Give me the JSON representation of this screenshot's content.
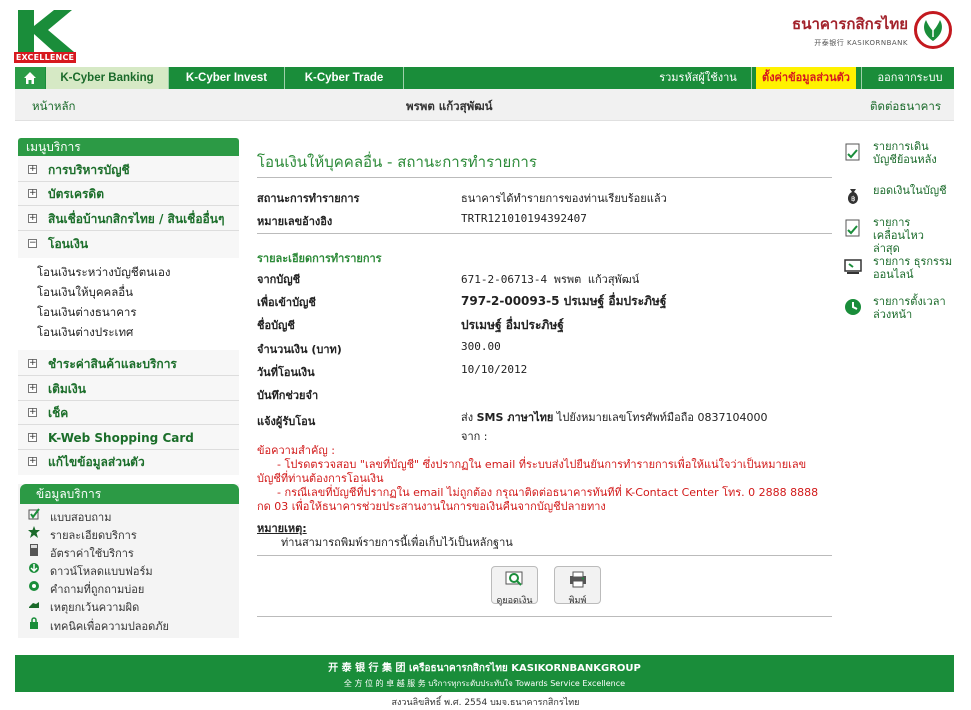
{
  "brand": {
    "k_excellence": "EXCELLENCE",
    "bank_name_th": "ธนาคารกสิกรไทย",
    "bank_name_en": "开泰银行 KASIKORNBANK",
    "brand_green": "#1a8d3a",
    "brand_red": "#d7191f"
  },
  "topnav": {
    "home_icon": "home-icon",
    "tabs": [
      "K-Cyber Banking",
      "K-Cyber Invest",
      "K-Cyber Trade"
    ],
    "change_password": "รวมรหัสผู้ใช้งาน",
    "settings": "ตั้งค่าข้อมูลส่วนตัว",
    "logout": "ออกจากระบบ"
  },
  "subbar": {
    "home": "หน้าหลัก",
    "user_name": "พรพต แก้วสุพัฒน์",
    "contact": "ติดต่อธนาคาร"
  },
  "menu": {
    "title": "เมนูบริการ",
    "items": [
      {
        "label": "การบริหารบัญชี",
        "sign": "⊞"
      },
      {
        "label": "บัตรเครดิต",
        "sign": "⊞"
      },
      {
        "label": "สินเชื่อบ้านกสิกรไทย / สินเชื่ออื่นๆ",
        "sign": "⊞"
      },
      {
        "label": "โอนเงิน",
        "sign": "⊟"
      },
      {
        "label": "ชำระค่าสินค้าและบริการ",
        "sign": "⊞"
      },
      {
        "label": "เติมเงิน",
        "sign": "⊞"
      },
      {
        "label": "เช็ค",
        "sign": "⊞"
      },
      {
        "label": "K-Web Shopping Card",
        "sign": "⊞"
      },
      {
        "label": "แก้ไขข้อมูลส่วนตัว",
        "sign": "⊞"
      }
    ],
    "transfer_sub": [
      "โอนเงินระหว่างบัญชีตนเอง",
      "โอนเงินให้บุคคลอื่น",
      "โอนเงินต่างธนาคาร",
      "โอนเงินต่างประเทศ"
    ]
  },
  "info": {
    "title": "ข้อมูลบริการ",
    "items": [
      {
        "label": "แบบสอบถาม",
        "icon": "checkbox-icon"
      },
      {
        "label": "รายละเอียดบริการ",
        "icon": "star-icon"
      },
      {
        "label": "อัตราค่าใช้บริการ",
        "icon": "calculator-icon"
      },
      {
        "label": "ดาวน์โหลดแบบฟอร์ม",
        "icon": "download-icon"
      },
      {
        "label": "คำถามที่ถูกถามบ่อย",
        "icon": "question-icon"
      },
      {
        "label": "เหตุยกเว้นความผิด",
        "icon": "hand-icon"
      },
      {
        "label": "เทคนิคเพื่อความปลอดภัย",
        "icon": "lock-icon"
      }
    ]
  },
  "main": {
    "title": "โอนเงินให้บุคคลอื่น - สถานะการทำรายการ",
    "status_label": "สถานะการทำรายการ",
    "status_value": "ธนาคารได้ทำรายการของท่านเรียบร้อยแล้ว",
    "ref_label": "หมายเลขอ้างอิง",
    "ref_value": "TRTR121010194392407",
    "detail_head": "รายละเอียดการทำรายการ",
    "from_label": "จากบัญชี",
    "from_value": "671-2-06713-4 พรพต แก้วสุพัฒน์",
    "to_label": "เพื่อเข้าบัญชี",
    "to_value": "797-2-00093-5 ปรเมษฐ์ อื่มประภิษฐ์",
    "acctname_label": "ชื่อบัญชี",
    "acctname_value": "ปรเมษฐ์ อื่มประภิษฐ์",
    "amount_label": "จำนวนเงิน (บาท)",
    "amount_value": "300.00",
    "date_label": "วันที่โอนเงิน",
    "date_value": "10/10/2012",
    "memo_label": "บันทึกช่วยจำ",
    "memo_value": "",
    "notify_label": "แจ้งผู้รับโอน",
    "notify_value_pre": "ส่ง ",
    "notify_value_bold": "SMS ภาษาไทย",
    "notify_value_post": " ไปยังหมายเลขโทรศัพท์มือถือ 0837104000",
    "notify_value_line2": "จาก :",
    "notice_head": "ข้อความสำคัญ :",
    "notice_1": "- โปรดตรวจสอบ \"เลขที่บัญชี\" ซึ่งปรากฏใน email ที่ระบบส่งไปยืนยันการทำรายการเพื่อให้แน่ใจว่าเป็นหมายเลขบัญชีที่ท่านต้องการโอนเงิน",
    "notice_2": "- กรณีเลขที่บัญชีที่ปรากฏใน email ไม่ถูกต้อง กรุณาติดต่อธนาคารทันทีที่ K-Contact Center โทร. 0 2888 8888 กด 03 เพื่อให้ธนาคารช่วยประสานงานในการขอเงินคืนจากบัญชีปลายทาง",
    "remark_head": "หมายเหตุ:",
    "remark_text": "ท่านสามารถพิมพ์รายการนี้เพื่อเก็บไว้เป็นหลักฐาน",
    "btn_balance": "ดูยอดเงิน",
    "btn_print": "พิมพ์"
  },
  "side_links": [
    {
      "label": "รายการเดิน บัญชีย้อนหลัง",
      "icon": "statement-icon"
    },
    {
      "label": "ยอดเงินในบัญชี",
      "icon": "moneybag-icon"
    },
    {
      "label": "รายการ เคลื่อนไหวล่าสุด",
      "icon": "recent-icon"
    },
    {
      "label": "รายการ ธุรกรรมออนไลน์",
      "icon": "online-icon"
    },
    {
      "label": "รายการตั้งเวลา ล่วงหน้า",
      "icon": "clock-icon"
    }
  ],
  "footer": {
    "line1": "开 泰 银 行 集 团 เครือธนาคารกสิกรไทย KASIKORNBANKGROUP",
    "line2": "全 方 位 的 卓 越 服 务 บริการทุกระดับประทับใจ Towards Service Excellence",
    "copyright": "สงวนลิขสิทธิ์ พ.ศ. 2554 บมจ.ธนาคารกสิกรไทย"
  }
}
